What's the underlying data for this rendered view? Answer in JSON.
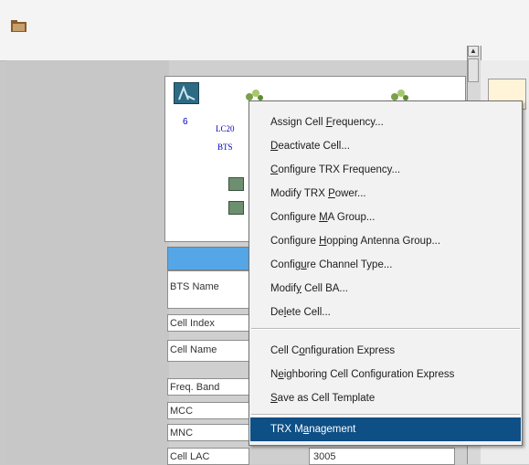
{
  "toolbar": {
    "folder_icon": "folder-icon"
  },
  "topology": {
    "bts_number": "6",
    "cell_name_short": "LC20",
    "cell_sub": "BTS"
  },
  "properties": {
    "header": "",
    "rows": [
      {
        "label": "BTS Name",
        "value": ""
      },
      {
        "label": "Cell Index",
        "value": ""
      },
      {
        "label": "Cell Name",
        "value": ""
      },
      {
        "label": "Freq. Band",
        "value": ""
      },
      {
        "label": "MCC",
        "value": ""
      },
      {
        "label": "MNC",
        "value": ""
      },
      {
        "label": "Cell LAC",
        "value": "3005"
      }
    ]
  },
  "context_menu": {
    "items": [
      {
        "pre": "Assign Cell ",
        "u": "F",
        "post": "requency..."
      },
      {
        "pre": "",
        "u": "D",
        "post": "eactivate Cell..."
      },
      {
        "pre": "",
        "u": "C",
        "post": "onfigure TRX Frequency..."
      },
      {
        "pre": "Modify TRX ",
        "u": "P",
        "post": "ower..."
      },
      {
        "pre": "Configure ",
        "u": "M",
        "post": "A Group..."
      },
      {
        "pre": "Configure ",
        "u": "H",
        "post": "opping Antenna Group..."
      },
      {
        "pre": "Config",
        "u": "u",
        "post": "re Channel Type..."
      },
      {
        "pre": "Modif",
        "u": "y",
        "post": " Cell BA..."
      },
      {
        "pre": "De",
        "u": "l",
        "post": "ete Cell..."
      },
      {
        "pre": "Cell C",
        "u": "o",
        "post": "nfiguration Express"
      },
      {
        "pre": "N",
        "u": "e",
        "post": "ighboring Cell Configuration Express"
      },
      {
        "pre": "",
        "u": "S",
        "post": "ave as Cell Template"
      },
      {
        "pre": "TRX M",
        "u": "a",
        "post": "nagement"
      }
    ],
    "selected_index": 12
  }
}
